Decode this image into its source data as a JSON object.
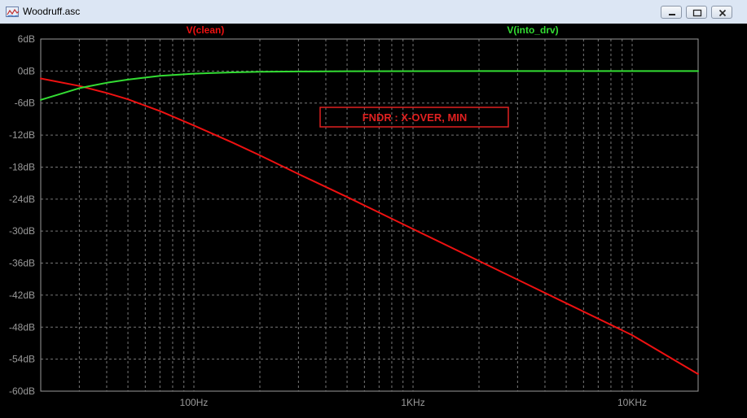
{
  "window": {
    "title": "Woodruff.asc",
    "buttons": [
      {
        "name": "minimize-button",
        "icon": "minimize-icon"
      },
      {
        "name": "maximize-button",
        "icon": "maximize-icon"
      },
      {
        "name": "close-button",
        "icon": "close-icon"
      }
    ]
  },
  "chart_data": {
    "type": "line",
    "title": "",
    "xlabel": "",
    "ylabel": "",
    "x_scale": "log",
    "xlim_hz": [
      20,
      20000
    ],
    "ylim_db": [
      -60,
      6
    ],
    "grid": true,
    "background": "#000000",
    "x_ticks": [
      {
        "value": 100,
        "label": "100Hz"
      },
      {
        "value": 1000,
        "label": "1KHz"
      },
      {
        "value": 10000,
        "label": "10KHz"
      }
    ],
    "y_ticks": [
      {
        "value": 6,
        "label": "6dB"
      },
      {
        "value": 0,
        "label": "0dB"
      },
      {
        "value": -6,
        "label": "-6dB"
      },
      {
        "value": -12,
        "label": "-12dB"
      },
      {
        "value": -18,
        "label": "-18dB"
      },
      {
        "value": -24,
        "label": "-24dB"
      },
      {
        "value": -30,
        "label": "-30dB"
      },
      {
        "value": -36,
        "label": "-36dB"
      },
      {
        "value": -42,
        "label": "-42dB"
      },
      {
        "value": -48,
        "label": "-48dB"
      },
      {
        "value": -54,
        "label": "-54dB"
      },
      {
        "value": -60,
        "label": "-60dB"
      }
    ],
    "series": [
      {
        "name": "V(clean)",
        "color": "#ee1111",
        "x": [
          20,
          30,
          40,
          50,
          70,
          100,
          150,
          200,
          300,
          500,
          1000,
          2000,
          5000,
          10000,
          20000
        ],
        "y": [
          -1.4,
          -2.8,
          -4.1,
          -5.3,
          -7.5,
          -10.2,
          -13.4,
          -15.8,
          -19.3,
          -23.6,
          -29.6,
          -35.6,
          -43.5,
          -49.5,
          -56.8
        ]
      },
      {
        "name": "V(into_drv)",
        "color": "#33dd33",
        "x": [
          20,
          25,
          30,
          40,
          50,
          70,
          100,
          150,
          200,
          300,
          500,
          1000,
          2000,
          5000,
          10000,
          20000
        ],
        "y": [
          -5.4,
          -4.2,
          -3.2,
          -2.2,
          -1.6,
          -0.9,
          -0.5,
          -0.25,
          -0.15,
          -0.08,
          -0.04,
          -0.02,
          0,
          0,
          0,
          0
        ]
      }
    ],
    "annotations": [
      {
        "text": "FNDR : X-OVER, MIN",
        "color": "#e02020",
        "boxed": true
      }
    ]
  }
}
